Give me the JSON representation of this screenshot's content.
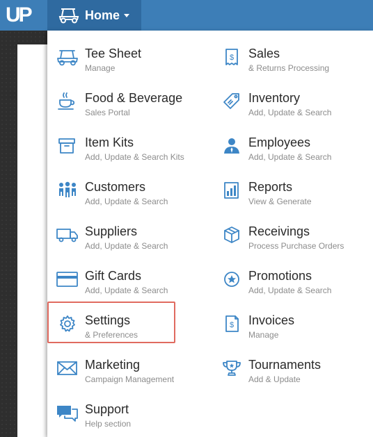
{
  "app": {
    "logo_text": "UP",
    "home_label": "Home"
  },
  "menu": {
    "left": [
      {
        "title": "Tee Sheet",
        "sub": "Manage",
        "icon": "golf-cart-icon"
      },
      {
        "title": "Food & Beverage",
        "sub": "Sales Portal",
        "icon": "coffee-cup-icon"
      },
      {
        "title": "Item Kits",
        "sub": "Add, Update & Search Kits",
        "icon": "box-icon"
      },
      {
        "title": "Customers",
        "sub": "Add, Update & Search",
        "icon": "people-icon"
      },
      {
        "title": "Suppliers",
        "sub": "Add, Update & Search",
        "icon": "truck-icon"
      },
      {
        "title": "Gift Cards",
        "sub": "Add, Update & Search",
        "icon": "credit-card-icon"
      },
      {
        "title": "Settings",
        "sub": "& Preferences",
        "icon": "gear-icon"
      },
      {
        "title": "Marketing",
        "sub": "Campaign Management",
        "icon": "envelope-icon"
      },
      {
        "title": "Support",
        "sub": "Help section",
        "icon": "chat-bubbles-icon"
      }
    ],
    "right": [
      {
        "title": "Sales",
        "sub": "& Returns Processing",
        "icon": "receipt-icon"
      },
      {
        "title": "Inventory",
        "sub": "Add, Update & Search",
        "icon": "tag-icon"
      },
      {
        "title": "Employees",
        "sub": "Add, Update & Search",
        "icon": "employee-icon"
      },
      {
        "title": "Reports",
        "sub": "View & Generate",
        "icon": "report-icon"
      },
      {
        "title": "Receivings",
        "sub": "Process Purchase Orders",
        "icon": "package-icon"
      },
      {
        "title": "Promotions",
        "sub": "Add, Update & Search",
        "icon": "star-badge-icon"
      },
      {
        "title": "Invoices",
        "sub": "Manage",
        "icon": "invoice-icon"
      },
      {
        "title": "Tournaments",
        "sub": "Add & Update",
        "icon": "trophy-icon"
      }
    ]
  },
  "colors": {
    "topbar": "#3d7eb7",
    "home_active": "#2f6aa0",
    "icon": "#3d86c6",
    "highlight": "#e06a5f"
  }
}
